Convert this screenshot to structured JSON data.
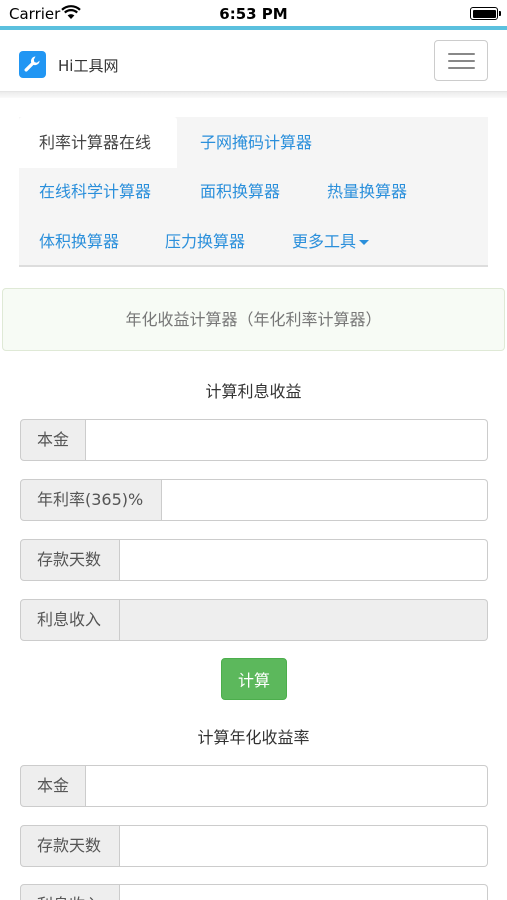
{
  "status_bar": {
    "carrier": "Carrier",
    "time": "6:53 PM"
  },
  "navbar": {
    "brand": "Hi工具网",
    "logo_icon": "wrench-icon",
    "menu_icon": "hamburger-menu-icon"
  },
  "tabs": [
    {
      "label": "利率计算器在线",
      "active": true
    },
    {
      "label": "子网掩码计算器"
    },
    {
      "label": "在线科学计算器"
    },
    {
      "label": "面积换算器"
    },
    {
      "label": "热量换算器"
    },
    {
      "label": "体积换算器"
    },
    {
      "label": "压力换算器"
    },
    {
      "label": "更多工具",
      "has_dropdown": true
    }
  ],
  "alert": {
    "text": "年化收益计算器（年化利率计算器）"
  },
  "interest_section": {
    "title": "计算利息收益",
    "fields": [
      {
        "label": "本金",
        "value": ""
      },
      {
        "label": "年利率(365)%",
        "value": ""
      },
      {
        "label": "存款天数",
        "value": ""
      },
      {
        "label": "利息收入",
        "value": "",
        "readonly": true
      }
    ],
    "button_label": "计算"
  },
  "rate_section": {
    "title": "计算年化收益率",
    "fields": [
      {
        "label": "本金",
        "value": ""
      },
      {
        "label": "存款天数",
        "value": ""
      },
      {
        "label": "利息收入",
        "value": ""
      }
    ]
  },
  "colors": {
    "accent": "#5bc0de",
    "link": "#2a8fdb",
    "button": "#5cb85c",
    "logo": "#2196f3"
  }
}
